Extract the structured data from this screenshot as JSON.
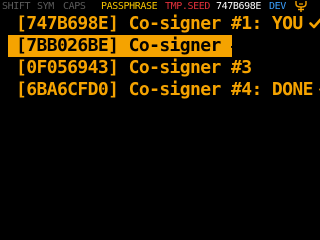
{
  "statusbar": {
    "shift": "SHIFT",
    "sym": "SYM",
    "caps": "CAPS",
    "passphrase": "PASSPHRASE",
    "tmp_seed": "TMP.SEED",
    "xfp": "747B698E",
    "dev": "DEV",
    "device_icon": "usb-plug-icon"
  },
  "menu": {
    "items": [
      {
        "label": "[747B698E] Co-signer #1: YOU",
        "selected": false,
        "checked": true
      },
      {
        "label": "[7BB026BE] Co-signer #2",
        "selected": true,
        "checked": false
      },
      {
        "label": "[0F056943] Co-signer #3",
        "selected": false,
        "checked": false
      },
      {
        "label": "[6BA6CFD0] Co-signer #4: DONE",
        "selected": false,
        "checked": true
      }
    ]
  },
  "colors": {
    "background": "#000000",
    "accent": "#f5a300",
    "passphrase": "#f5c400",
    "tmp_seed": "#e0303a",
    "dev": "#3aa0ff",
    "dim": "#5a5a5a"
  }
}
